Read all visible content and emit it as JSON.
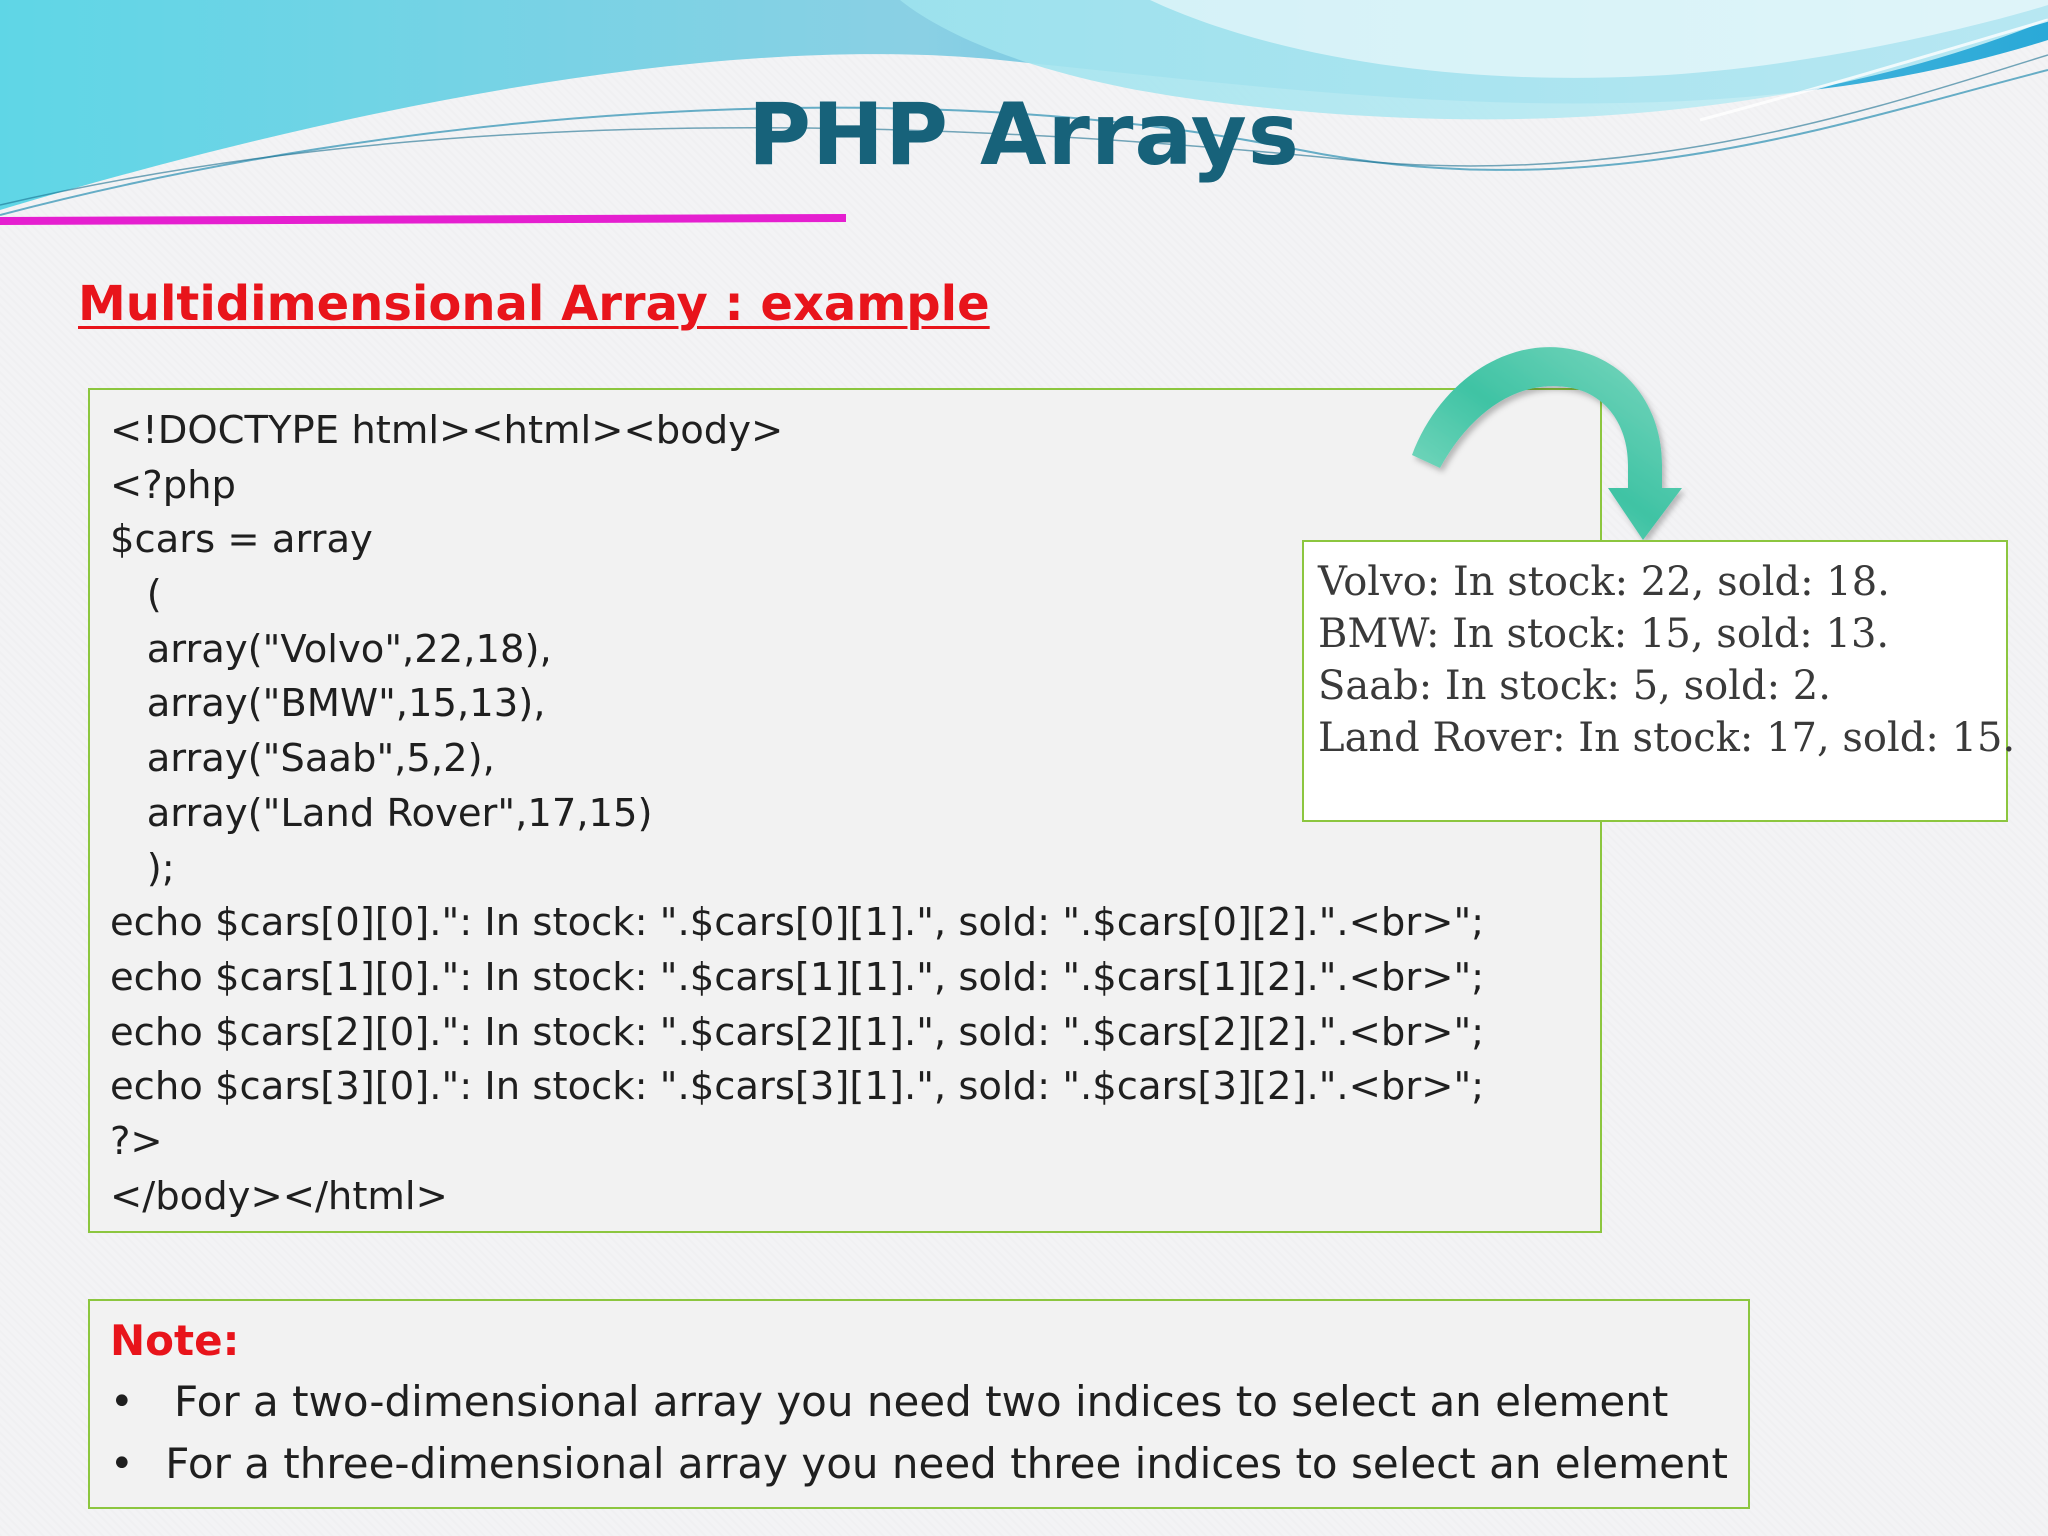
{
  "slide": {
    "title": "PHP Arrays",
    "subtitle": "Multidimensional Array : example"
  },
  "code": {
    "lines": [
      "<!DOCTYPE html><html><body>",
      "<?php",
      "$cars = array",
      "   (",
      "   array(\"Volvo\",22,18),",
      "   array(\"BMW\",15,13),",
      "   array(\"Saab\",5,2),",
      "   array(\"Land Rover\",17,15)",
      "   );",
      "echo $cars[0][0].\": In stock: \".$cars[0][1].\", sold: \".$cars[0][2].\".<br>\";",
      "echo $cars[1][0].\": In stock: \".$cars[1][1].\", sold: \".$cars[1][2].\".<br>\";",
      "echo $cars[2][0].\": In stock: \".$cars[2][1].\", sold: \".$cars[2][2].\".<br>\";",
      "echo $cars[3][0].\": In stock: \".$cars[3][1].\", sold: \".$cars[3][2].\".<br>\";",
      "?>",
      "</body></html>"
    ]
  },
  "output": {
    "lines": [
      "Volvo: In stock: 22, sold: 18.",
      "BMW: In stock: 15, sold: 13.",
      "Saab: In stock: 5, sold: 2.",
      "Land Rover: In stock: 17, sold: 15."
    ]
  },
  "note": {
    "title": "Note:",
    "bullet": "•",
    "items": [
      "For a two-dimensional array you need two indices to select an element",
      "For a three-dimensional array you need three indices to select an element"
    ]
  },
  "colors": {
    "title": "#17627a",
    "subtitle": "#e8141b",
    "border": "#8cc63f",
    "accent_line": "#e51fd0",
    "arrow": "#3fc3a4"
  }
}
